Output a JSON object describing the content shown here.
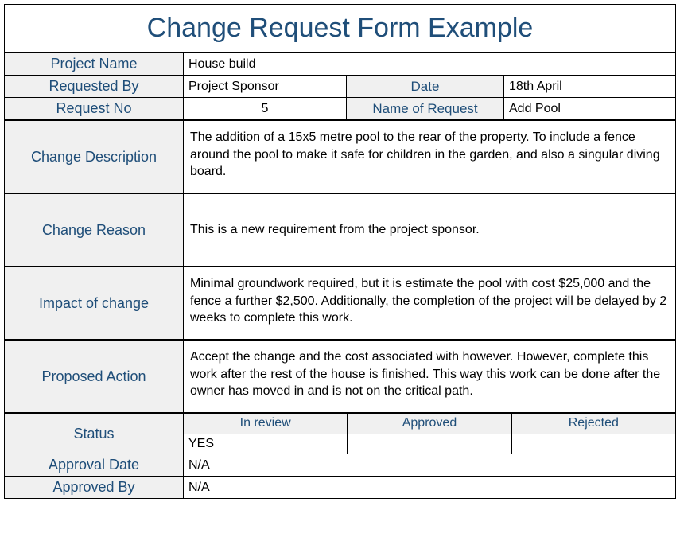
{
  "title": "Change Request Form Example",
  "labels": {
    "project_name": "Project Name",
    "requested_by": "Requested By",
    "date": "Date",
    "request_no": "Request No",
    "name_of_request": "Name of Request",
    "change_description": "Change Description",
    "change_reason": "Change Reason",
    "impact_of_change": "Impact of change",
    "proposed_action": "Proposed Action",
    "status": "Status",
    "approval_date": "Approval Date",
    "approved_by": "Approved By",
    "status_in_review": "In review",
    "status_approved": "Approved",
    "status_rejected": "Rejected"
  },
  "values": {
    "project_name": "House build",
    "requested_by": "Project Sponsor",
    "date": "18th April",
    "request_no": "5",
    "name_of_request": "Add Pool",
    "change_description": "The addition of a 15x5 metre pool to the rear of the property. To include a fence around the pool to make it safe for children in the garden, and also a singular diving board.",
    "change_reason": "This is a new requirement from the project sponsor.",
    "impact_of_change": "Minimal groundwork required, but it is estimate the pool with cost $25,000 and the fence a further $2,500. Additionally, the completion of the project will be delayed by 2 weeks to complete this work.",
    "proposed_action": "Accept the change and the cost associated with however. However, complete this work after the rest of the house is finished. This way this work can be done after the owner has moved in and is not on the critical path.",
    "status_in_review": "YES",
    "status_approved": "",
    "status_rejected": "",
    "approval_date": "N/A",
    "approved_by": "N/A"
  }
}
